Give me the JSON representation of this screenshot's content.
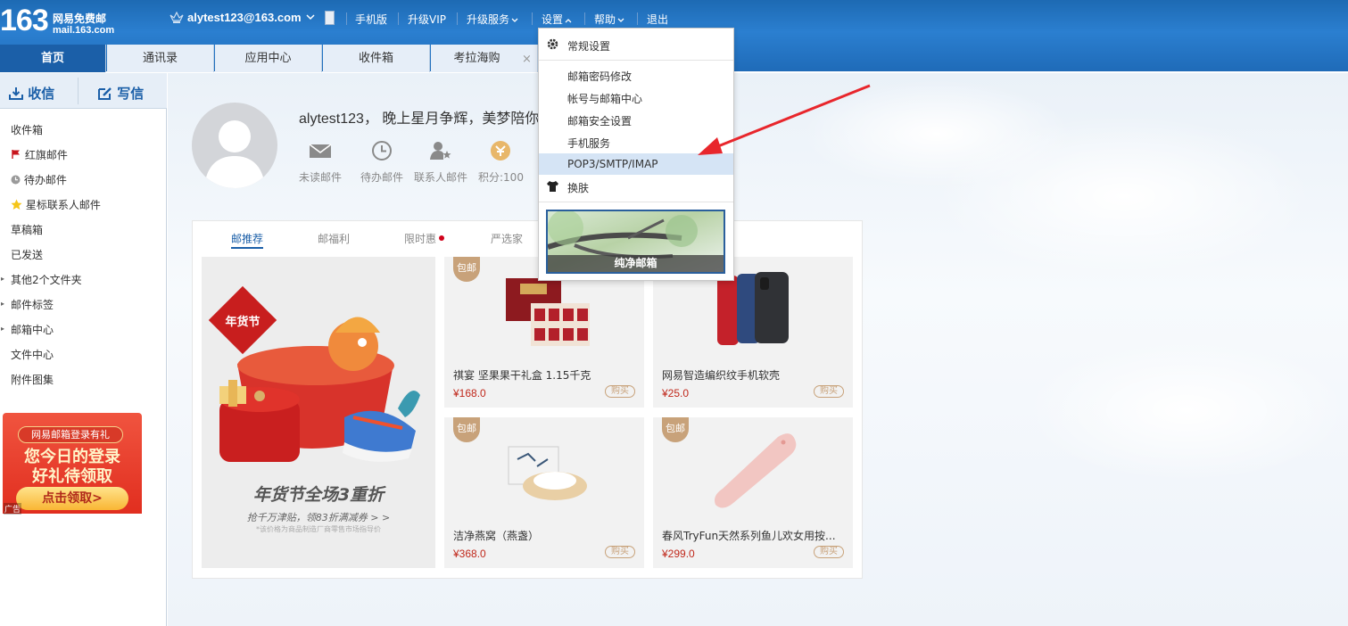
{
  "header": {
    "logo_number": "163",
    "logo_name": "网易免费邮",
    "logo_domain": "mail.163.com",
    "account": "alytest123@163.com",
    "nav": [
      "手机版",
      "升级VIP",
      "升级服务",
      "设置",
      "帮助",
      "退出"
    ]
  },
  "tabs": [
    "首页",
    "通讯录",
    "应用中心",
    "收件箱",
    "考拉海购"
  ],
  "tab_close": "×",
  "sidebar": {
    "receive": "收信",
    "compose": "写信",
    "folders": [
      "收件箱",
      "红旗邮件",
      "待办邮件",
      "星标联系人邮件",
      "草稿箱",
      "已发送",
      "其他2个文件夹",
      "邮件标签",
      "邮箱中心",
      "文件中心",
      "附件图集"
    ],
    "promo": {
      "banner": "网易邮箱登录有礼",
      "line1": "您今日的登录",
      "line2": "好礼待领取",
      "cta": "点击领取>",
      "ad": "广告"
    }
  },
  "main": {
    "greeting": "alytest123， 晚上星月争辉，美梦陪你",
    "quick": [
      "未读邮件",
      "待办邮件",
      "联系人邮件",
      "积分:100"
    ],
    "shop_tabs": [
      "邮推荐",
      "邮福利",
      "限时惠",
      "严选家"
    ],
    "big_promo": {
      "stamp": "年货节",
      "title": "年货节全场3重折",
      "subtitle": "抢千万津贴，领83折满减券 > >",
      "note": "*该价格为商品制造厂商零售市场指导价"
    },
    "products": [
      {
        "badge": "包邮",
        "name": "祺宴 坚果果干礼盒 1.15千克",
        "price": "¥168.0",
        "buy": "购买"
      },
      {
        "badge": "包邮",
        "name": "网易智造编织纹手机软壳",
        "price": "¥25.0",
        "buy": "购买"
      },
      {
        "badge": "包邮",
        "name": "洁净燕窝（燕盏）",
        "price": "¥368.0",
        "buy": "购买"
      },
      {
        "badge": "包邮",
        "name": "春风TryFun天然系列鱼儿欢女用按...",
        "price": "¥299.0",
        "buy": "购买"
      }
    ]
  },
  "settings_menu": {
    "general": "常规设置",
    "items": [
      "邮箱密码修改",
      "帐号与邮箱中心",
      "邮箱安全设置",
      "手机服务",
      "POP3/SMTP/IMAP"
    ],
    "skin": "换肤",
    "theme_caption": "纯净邮箱"
  },
  "colors": {
    "header_blue": "#1d6ab3",
    "active_tab": "#1b5fa8",
    "price_red": "#c0281b",
    "badge_gold": "#c8a27a",
    "menu_highlight": "#d5e4f5"
  }
}
